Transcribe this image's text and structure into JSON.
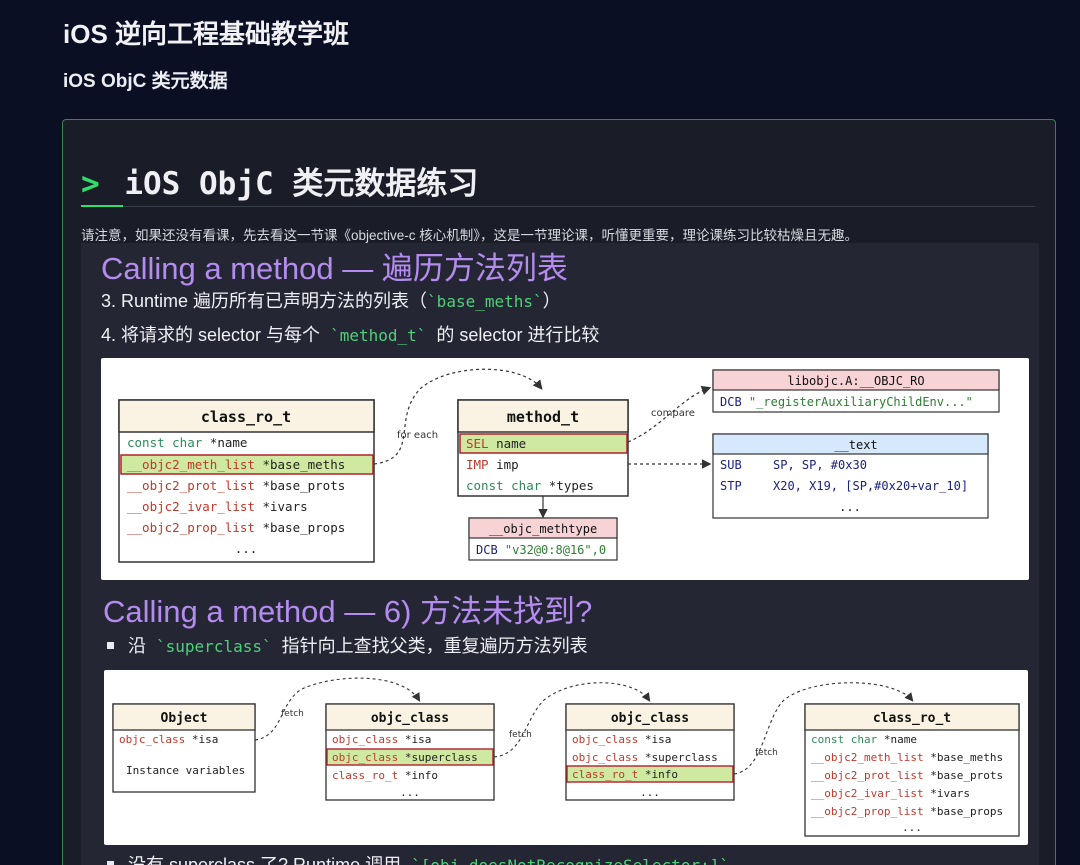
{
  "page": {
    "title": "iOS 逆向工程基础教学班",
    "subtitle": "iOS ObjC 类元数据"
  },
  "card": {
    "prompt": ">",
    "heading": "iOS ObjC 类元数据练习",
    "notice": "请注意，如果还没有看课，先去看这一节课《objective-c 核心机制》，这是一节理论课，听懂更重要，理论课练习比较枯燥且无趣。"
  },
  "slide1": {
    "title": "Calling a method — 遍历方法列表",
    "line1_prefix": "3. Runtime 遍历所有已声明方法的列表（",
    "line1_code": "`base_meths`",
    "line1_suffix": "）",
    "line2_prefix": "4. 将请求的 selector 与每个",
    "line2_code": "`method_t`",
    "line2_suffix": "的 selector 进行比较"
  },
  "diagram1": {
    "class_ro_t": {
      "title": "class_ro_t",
      "rows": [
        {
          "type": "const char",
          "field": "*name"
        },
        {
          "type": "__objc2_meth_list",
          "field": "*base_meths"
        },
        {
          "type": "__objc2_prot_list",
          "field": "*base_prots"
        },
        {
          "type": "__objc2_ivar_list",
          "field": "*ivars"
        },
        {
          "type": "__objc2_prop_list",
          "field": "*base_props"
        },
        {
          "type": "",
          "field": "..."
        }
      ]
    },
    "label_for_each": "for each",
    "label_compare": "compare",
    "method_t": {
      "title": "method_t",
      "rows": [
        {
          "type": "SEL",
          "field": "name"
        },
        {
          "type": "IMP",
          "field": "imp"
        },
        {
          "type": "const char",
          "field": "*types"
        }
      ]
    },
    "methtype": {
      "title": "__objc_methtype",
      "dcb": "DCB",
      "value": "\"v32@0:8@16\",0"
    },
    "objc_ro": {
      "title": "libobjc.A:__OBJC_RO",
      "dcb": "DCB",
      "value": "\"_registerAuxiliaryChildEnv...\""
    },
    "text_seg": {
      "title": "__text",
      "rows": [
        {
          "op": "SUB",
          "args": "SP, SP, #0x30"
        },
        {
          "op": "STP",
          "args": "X20, X19, [SP,#0x20+var_10]"
        },
        {
          "op": "",
          "args": "..."
        }
      ]
    }
  },
  "slide2": {
    "title": "Calling a method — 6) 方法未找到?",
    "bullet1_prefix": "沿",
    "bullet1_code": "`superclass`",
    "bullet1_suffix": "指针向上查找父类，重复遍历方法列表",
    "bullet2_prefix": "没有 superclass 了? Runtime 调用",
    "bullet2_code": "`[obj doesNotRecognizeSelector:]`"
  },
  "diagram2": {
    "object": {
      "title": "Object",
      "isa_type": "objc_class",
      "isa_field": "*isa",
      "ivars": "Instance variables"
    },
    "label_fetch": "fetch",
    "class1": {
      "title": "objc_class",
      "rows": [
        {
          "type": "objc_class",
          "field": "*isa"
        },
        {
          "type": "objc_class",
          "field": "*superclass"
        },
        {
          "type": "class_ro_t",
          "field": "*info"
        },
        {
          "type": "",
          "field": "..."
        }
      ]
    },
    "class2": {
      "title": "objc_class",
      "rows": [
        {
          "type": "objc_class",
          "field": "*isa"
        },
        {
          "type": "objc_class",
          "field": "*superclass"
        },
        {
          "type": "class_ro_t",
          "field": "*info"
        },
        {
          "type": "",
          "field": "..."
        }
      ]
    },
    "ro": {
      "title": "class_ro_t",
      "rows": [
        {
          "type": "const char",
          "field": "*name"
        },
        {
          "type": "__objc2_meth_list",
          "field": "*base_meths"
        },
        {
          "type": "__objc2_prot_list",
          "field": "*base_prots"
        },
        {
          "type": "__objc2_ivar_list",
          "field": "*ivars"
        },
        {
          "type": "__objc2_prop_list",
          "field": "*base_props"
        },
        {
          "type": "",
          "field": "..."
        }
      ]
    }
  },
  "colors": {
    "accent_green": "#2ee06a",
    "purple_title": "#b48cf0",
    "highlight_row": "#cfe9a0",
    "highlight_border": "#b3202e",
    "type_red": "#c0392b",
    "header_cream": "#faf3e3",
    "header_pink": "#f8d3d5",
    "header_blue": "#d6e8fb"
  }
}
